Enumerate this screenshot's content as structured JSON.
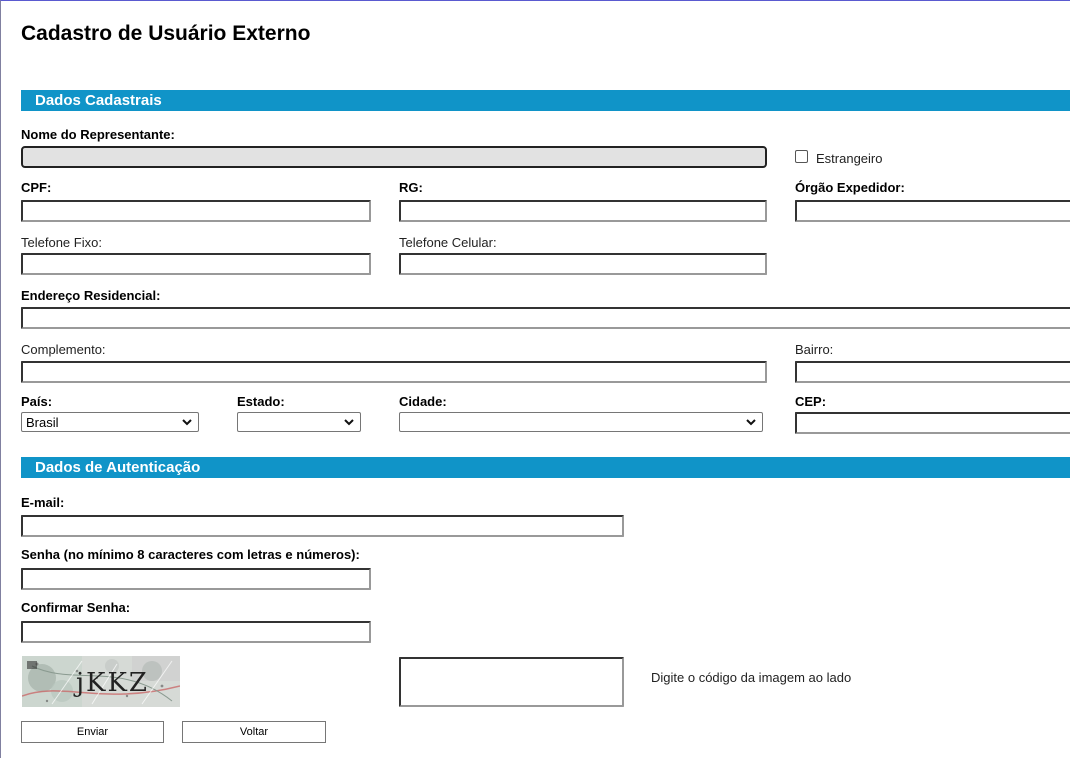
{
  "page": {
    "title": "Cadastro de Usuário Externo"
  },
  "sections": {
    "cadastrais": "Dados Cadastrais",
    "autenticacao": "Dados de Autenticação"
  },
  "fields": {
    "nome_representante": {
      "label": "Nome do Representante:",
      "value": ""
    },
    "estrangeiro": {
      "label": "Estrangeiro",
      "checked": false
    },
    "cpf": {
      "label": "CPF:",
      "value": ""
    },
    "rg": {
      "label": "RG:",
      "value": ""
    },
    "orgao_expedidor": {
      "label": "Órgão Expedidor:",
      "value": ""
    },
    "telefone_fixo": {
      "label": "Telefone Fixo:",
      "value": ""
    },
    "telefone_celular": {
      "label": "Telefone Celular:",
      "value": ""
    },
    "endereco": {
      "label": "Endereço Residencial:",
      "value": ""
    },
    "complemento": {
      "label": "Complemento:",
      "value": ""
    },
    "bairro": {
      "label": "Bairro:",
      "value": ""
    },
    "pais": {
      "label": "País:",
      "selected": "Brasil"
    },
    "estado": {
      "label": "Estado:",
      "selected": ""
    },
    "cidade": {
      "label": "Cidade:",
      "selected": ""
    },
    "cep": {
      "label": "CEP:",
      "value": ""
    },
    "email": {
      "label": "E-mail:",
      "value": ""
    },
    "senha": {
      "label": "Senha (no mínimo 8 caracteres com letras e números):",
      "value": ""
    },
    "confirmar_senha": {
      "label": "Confirmar Senha:",
      "value": ""
    },
    "captcha": {
      "image_text": "jKKZ",
      "hint": "Digite o código da imagem ao lado",
      "value": ""
    }
  },
  "buttons": {
    "enviar": "Enviar",
    "voltar": "Voltar"
  },
  "colors": {
    "section_bar": "#1094c8",
    "section_text": "#ffffff",
    "disabled_field": "#e2e2e2"
  },
  "icons": {
    "select_arrow": "chevron-down-icon",
    "checkbox": "checkbox-icon"
  }
}
